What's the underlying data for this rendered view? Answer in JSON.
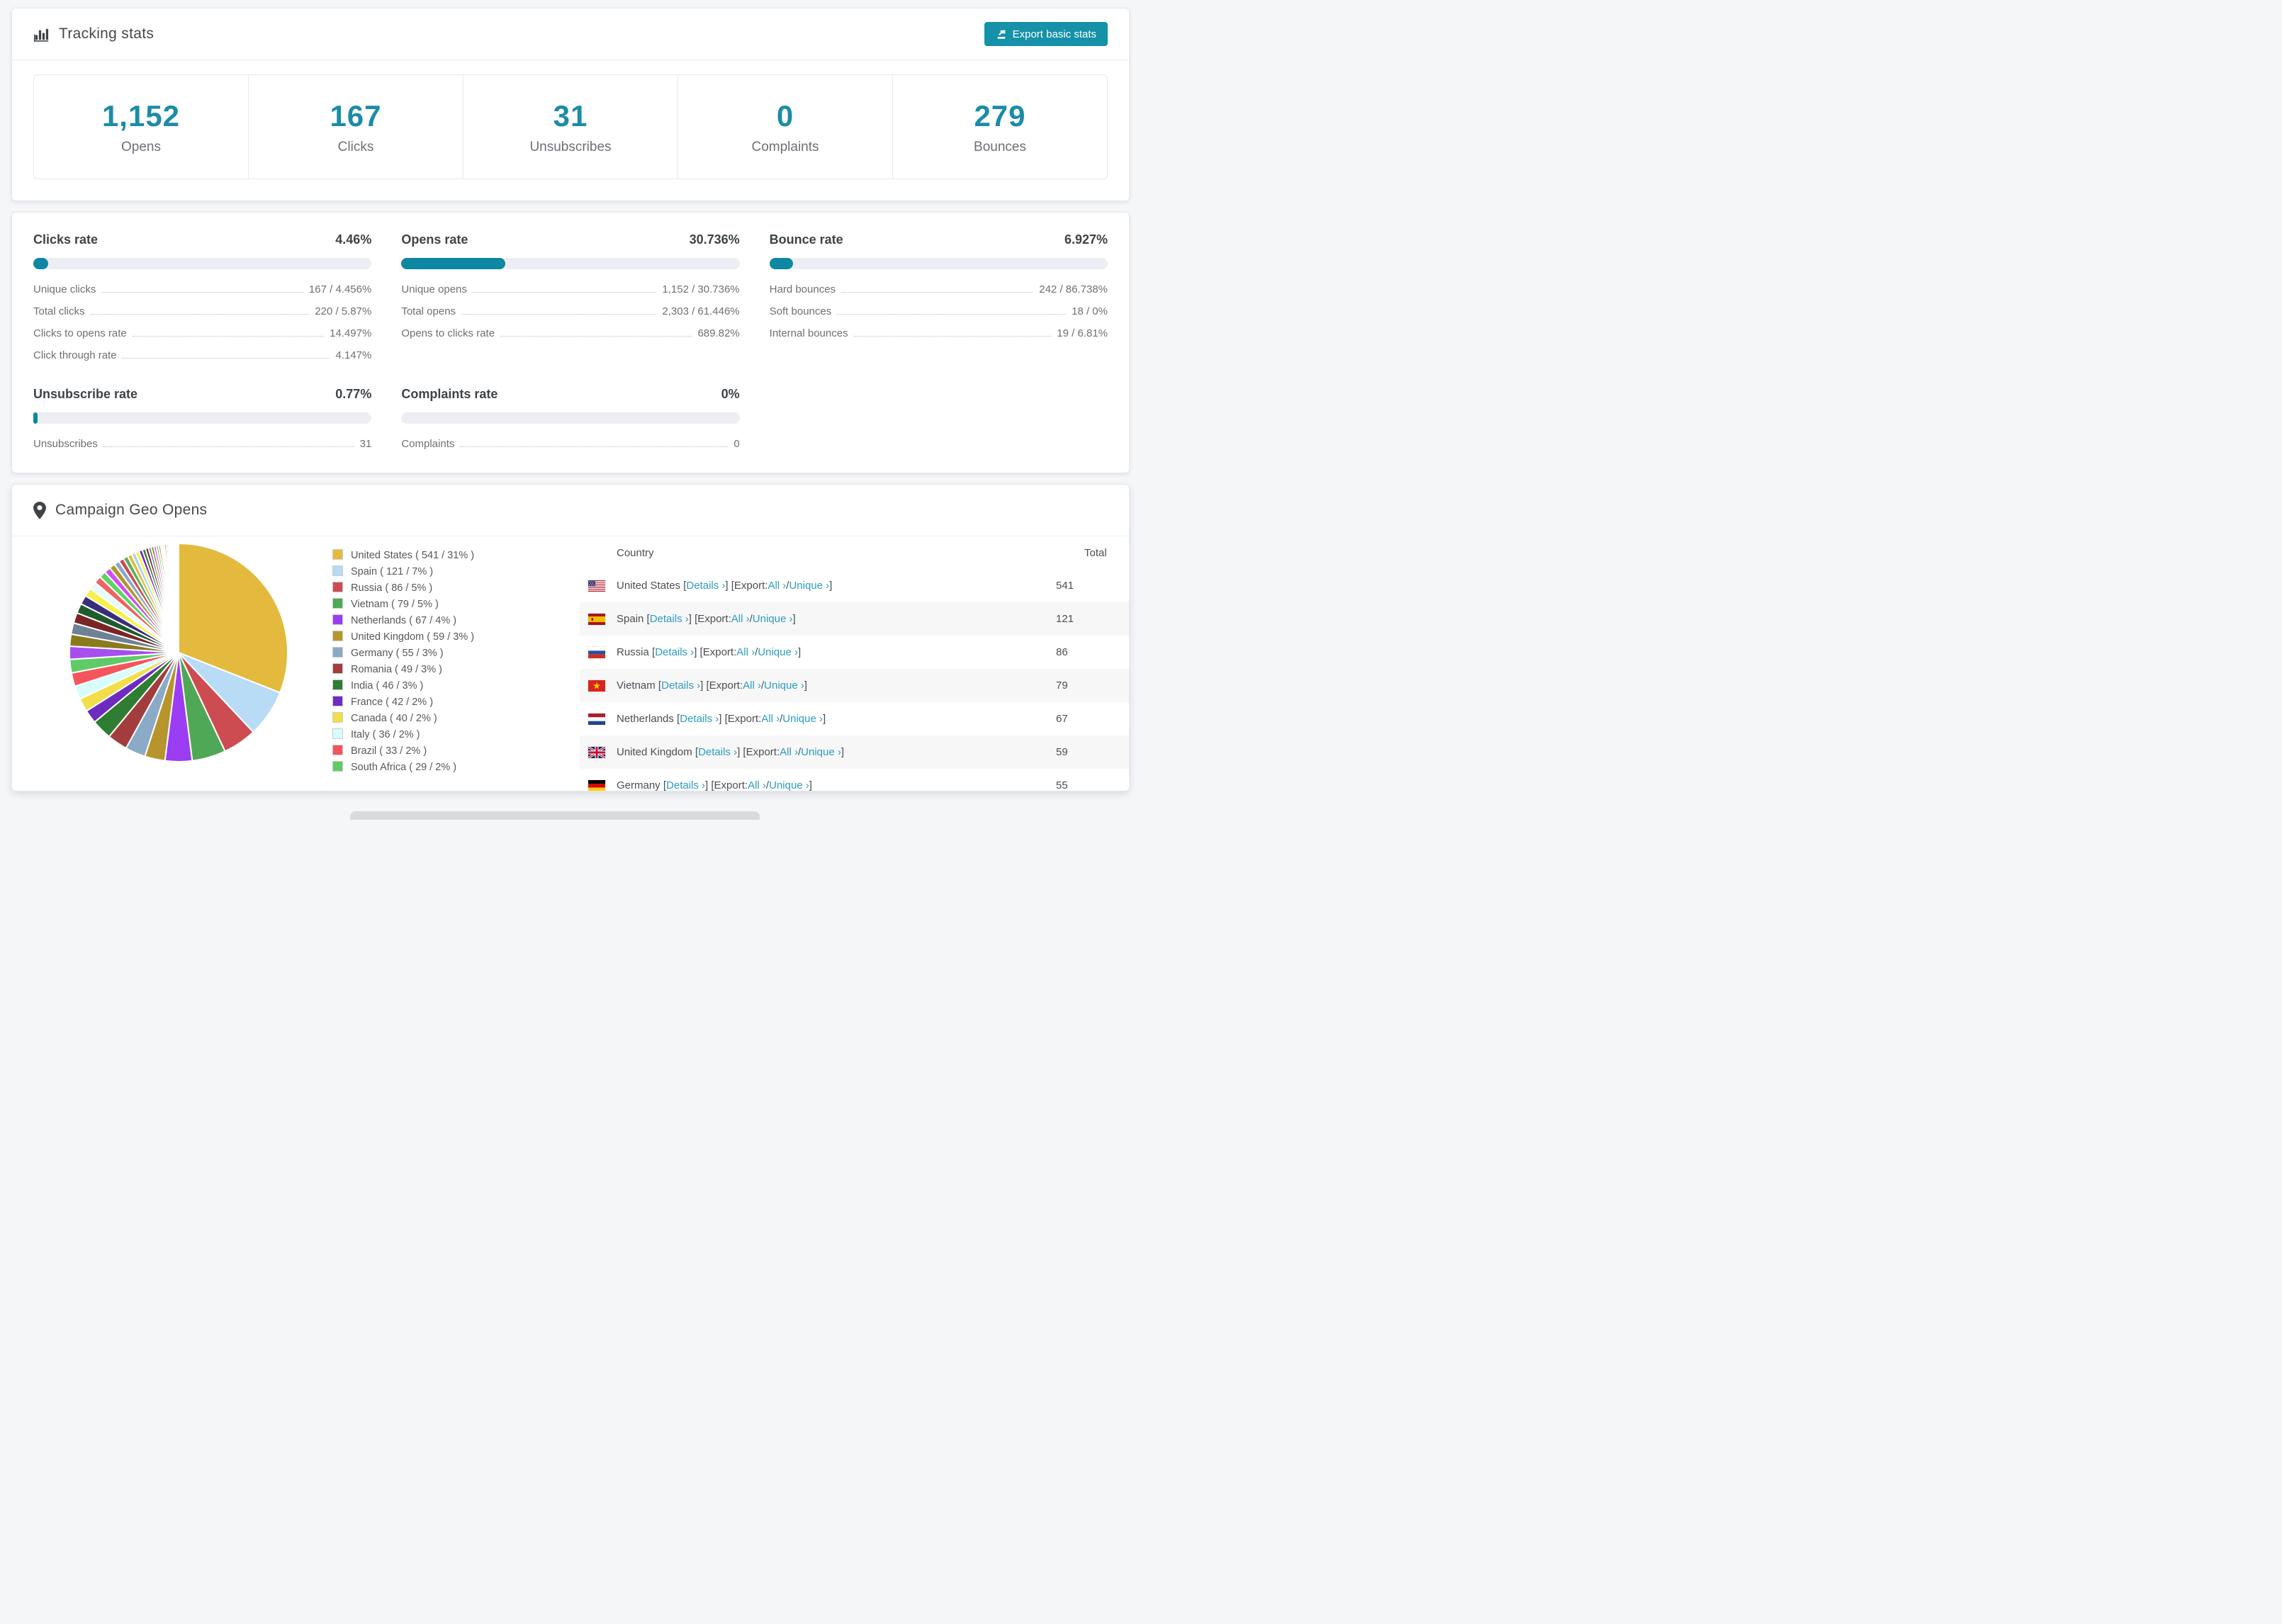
{
  "colors": {
    "accent_teal": "#1591a8",
    "bar_fill_teal": "#0d87a2",
    "stat_number_teal": "#1b8ca6",
    "link_teal": "#2b9cbd",
    "bar_track": "#eceef3",
    "row_alt_bg": "#f7f7f8"
  },
  "tracking": {
    "title": "Tracking stats",
    "export_button": "Export basic stats",
    "stats": [
      {
        "value": "1,152",
        "label": "Opens"
      },
      {
        "value": "167",
        "label": "Clicks"
      },
      {
        "value": "31",
        "label": "Unsubscribes"
      },
      {
        "value": "0",
        "label": "Complaints"
      },
      {
        "value": "279",
        "label": "Bounces"
      }
    ]
  },
  "rates": [
    {
      "title": "Clicks rate",
      "value": "4.46%",
      "fill_pct": 4.46,
      "rows": [
        {
          "label": "Unique clicks",
          "value": "167 / 4.456%"
        },
        {
          "label": "Total clicks",
          "value": "220 / 5.87%"
        },
        {
          "label": "Clicks to opens rate",
          "value": "14.497%"
        },
        {
          "label": "Click through rate",
          "value": "4.147%"
        }
      ]
    },
    {
      "title": "Opens rate",
      "value": "30.736%",
      "fill_pct": 30.736,
      "rows": [
        {
          "label": "Unique opens",
          "value": "1,152 / 30.736%"
        },
        {
          "label": "Total opens",
          "value": "2,303 / 61.446%"
        },
        {
          "label": "Opens to clicks rate",
          "value": "689.82%"
        }
      ]
    },
    {
      "title": "Bounce rate",
      "value": "6.927%",
      "fill_pct": 6.927,
      "rows": [
        {
          "label": "Hard bounces",
          "value": "242 / 86.738%"
        },
        {
          "label": "Soft bounces",
          "value": "18 / 0%"
        },
        {
          "label": "Internal bounces",
          "value": "19 / 6.81%"
        }
      ]
    },
    {
      "title": "Unsubscribe rate",
      "value": "0.77%",
      "fill_pct": 0.77,
      "rows": [
        {
          "label": "Unsubscribes",
          "value": "31"
        }
      ]
    },
    {
      "title": "Complaints rate",
      "value": "0%",
      "fill_pct": 0,
      "rows": [
        {
          "label": "Complaints",
          "value": "0"
        }
      ]
    }
  ],
  "geo": {
    "title": "Campaign Geo Opens",
    "table": {
      "col_country": "Country",
      "col_total": "Total",
      "details_label": "Details",
      "export_label": "Export:",
      "all_label": "All",
      "unique_label": "Unique",
      "chevron": "›",
      "rows": [
        {
          "country": "United States",
          "flag": "us",
          "total": "541"
        },
        {
          "country": "Spain",
          "flag": "es",
          "total": "121"
        },
        {
          "country": "Russia",
          "flag": "ru",
          "total": "86"
        },
        {
          "country": "Vietnam",
          "flag": "vn",
          "total": "79"
        },
        {
          "country": "Netherlands",
          "flag": "nl",
          "total": "67"
        },
        {
          "country": "United Kingdom",
          "flag": "gb",
          "total": "59"
        },
        {
          "country": "Germany",
          "flag": "de",
          "total": "55"
        }
      ]
    }
  },
  "chart_data": {
    "type": "pie",
    "title": "Campaign Geo Opens",
    "unit": "opens",
    "legend_position": "right",
    "slices": [
      {
        "label": "United States",
        "value": 541,
        "pct": 31,
        "color": "#e3ba3d"
      },
      {
        "label": "Spain",
        "value": 121,
        "pct": 7,
        "color": "#b8dcf5"
      },
      {
        "label": "Russia",
        "value": 86,
        "pct": 5,
        "color": "#cc4c52"
      },
      {
        "label": "Vietnam",
        "value": 79,
        "pct": 5,
        "color": "#4fa855"
      },
      {
        "label": "Netherlands",
        "value": 67,
        "pct": 4,
        "color": "#9b3df2"
      },
      {
        "label": "United Kingdom",
        "value": 59,
        "pct": 3,
        "color": "#b6952d"
      },
      {
        "label": "Germany",
        "value": 55,
        "pct": 3,
        "color": "#8aaac8"
      },
      {
        "label": "Romania",
        "value": 49,
        "pct": 3,
        "color": "#a33d3d"
      },
      {
        "label": "India",
        "value": 46,
        "pct": 3,
        "color": "#2e7d33"
      },
      {
        "label": "France",
        "value": 42,
        "pct": 2,
        "color": "#6f2bbf"
      },
      {
        "label": "Canada",
        "value": 40,
        "pct": 2,
        "color": "#f2de4a"
      },
      {
        "label": "Italy",
        "value": 36,
        "pct": 2,
        "color": "#d9fcfc"
      },
      {
        "label": "Brazil",
        "value": 33,
        "pct": 2,
        "color": "#f4555c"
      },
      {
        "label": "South Africa",
        "value": 29,
        "pct": 2,
        "color": "#5fcb66"
      }
    ],
    "other_slices": {
      "note": "many small unlabeled countries shown as thin slices",
      "total_pct": 26,
      "count": 40,
      "decay": 0.93,
      "colors": [
        "#a84df0",
        "#8a7a1e",
        "#6e8296",
        "#7a2525",
        "#1e5c2e",
        "#3a2d7a",
        "#f7f04a",
        "#e8fbfc",
        "#f06262",
        "#5fd464",
        "#d44df0",
        "#b0952b",
        "#8aaac8",
        "#cc4c52",
        "#55b05a",
        "#e3ba3d",
        "#a8d4f2",
        "#f7f04a",
        "#6f2bbf",
        "#2e7d33",
        "#7a2525",
        "#6e8296",
        "#8a7a1e",
        "#d44df0",
        "#5fd464",
        "#f06262",
        "#e8fbfc",
        "#f7f04a",
        "#3a2d7a",
        "#1e5c2e",
        "#7a2525",
        "#6e8296",
        "#b0952b",
        "#a84df0",
        "#55b05a",
        "#cc4c52",
        "#a8d4f2",
        "#e3ba3d",
        "#6f2bbf",
        "#f06262"
      ]
    }
  }
}
